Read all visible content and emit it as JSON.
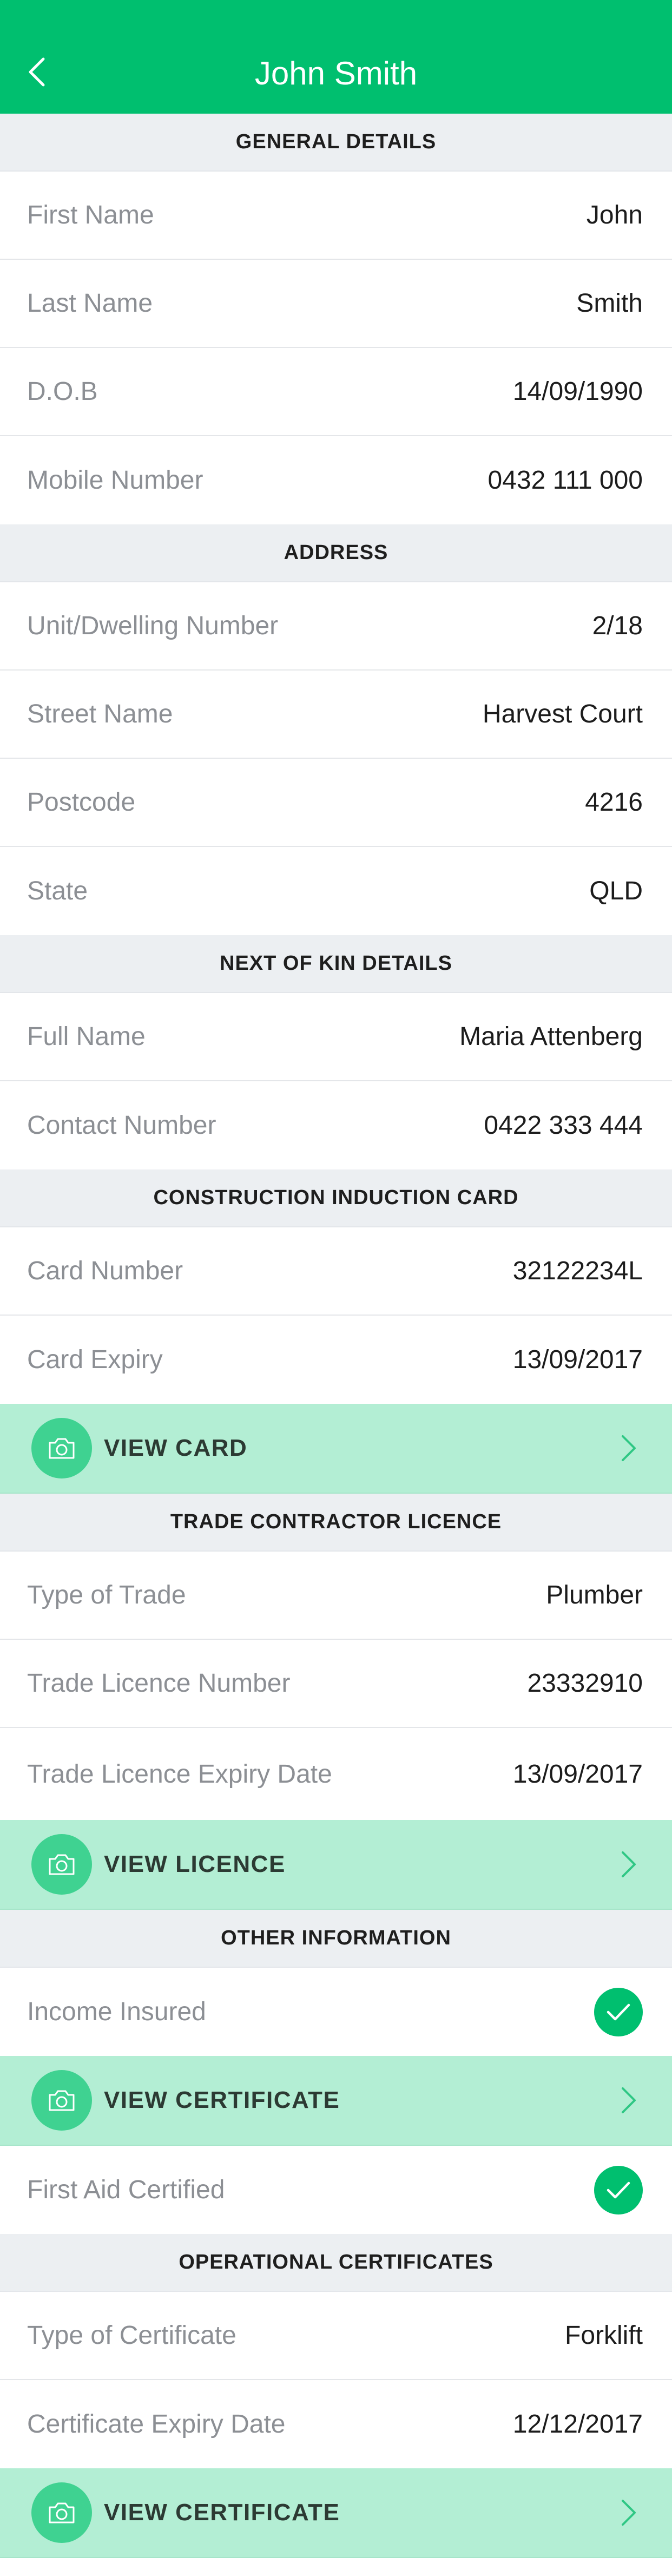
{
  "header": {
    "title": "John Smith"
  },
  "general": {
    "heading": "GENERAL DETAILS",
    "first_name": {
      "label": "First Name",
      "value": "John"
    },
    "last_name": {
      "label": "Last Name",
      "value": "Smith"
    },
    "dob": {
      "label": "D.O.B",
      "value": "14/09/1990"
    },
    "mobile": {
      "label": "Mobile Number",
      "value": "0432 111 000"
    }
  },
  "address": {
    "heading": "ADDRESS",
    "unit": {
      "label": "Unit/Dwelling Number",
      "value": "2/18"
    },
    "street": {
      "label": "Street Name",
      "value": "Harvest Court"
    },
    "postcode": {
      "label": "Postcode",
      "value": "4216"
    },
    "state": {
      "label": "State",
      "value": "QLD"
    }
  },
  "kin": {
    "heading": "NEXT OF KIN DETAILS",
    "full_name": {
      "label": "Full Name",
      "value": "Maria Attenberg"
    },
    "contact": {
      "label": "Contact Number",
      "value": "0422 333 444"
    }
  },
  "induction": {
    "heading": "CONSTRUCTION INDUCTION CARD",
    "card_number": {
      "label": "Card Number",
      "value": "32122234L"
    },
    "card_expiry": {
      "label": "Card Expiry",
      "value": "13/09/2017"
    },
    "action_label": "VIEW CARD"
  },
  "trade": {
    "heading": "TRADE CONTRACTOR LICENCE",
    "type": {
      "label": "Type of Trade",
      "value": "Plumber"
    },
    "number": {
      "label": "Trade Licence Number",
      "value": "23332910"
    },
    "expiry": {
      "label": "Trade Licence Expiry Date",
      "value": "13/09/2017"
    },
    "action_label": "VIEW LICENCE"
  },
  "other": {
    "heading": "OTHER INFORMATION",
    "income": {
      "label": "Income Insured",
      "checked": true
    },
    "income_action_label": "VIEW CERTIFICATE",
    "first_aid": {
      "label": "First Aid Certified",
      "checked": true
    }
  },
  "operational": {
    "heading": "OPERATIONAL CERTIFICATES",
    "type": {
      "label": "Type of Certificate",
      "value": "Forklift"
    },
    "expiry": {
      "label": "Certificate Expiry Date",
      "value": "12/12/2017"
    },
    "action_label": "VIEW CERTIFICATE"
  },
  "icons": {
    "back": "chevron-left-icon",
    "camera": "camera-icon",
    "chevron": "chevron-right-icon",
    "check": "checkmark-icon"
  },
  "colors": {
    "brand_green": "#00bf6f",
    "action_bg": "#b3eed4",
    "camera_circle": "#3fd291",
    "section_bg": "#eceff2"
  }
}
